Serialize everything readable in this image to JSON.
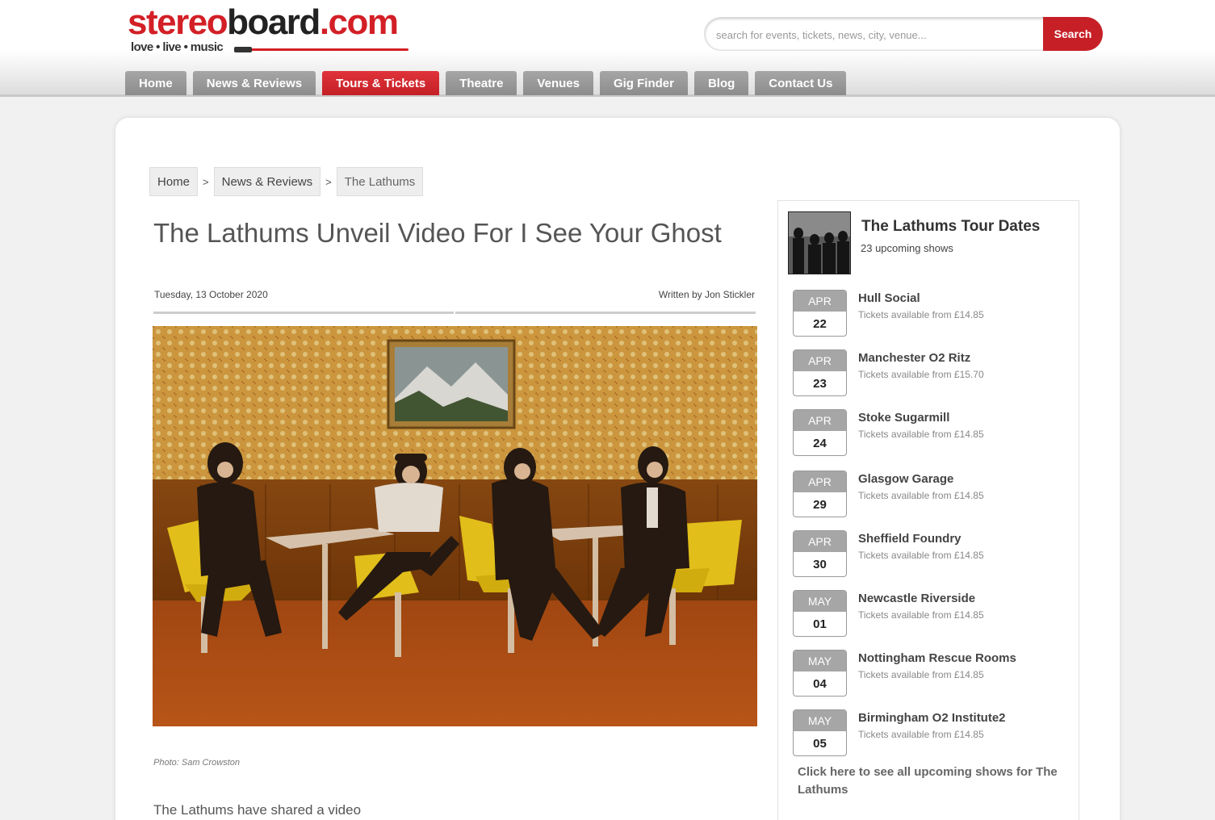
{
  "site": {
    "logo_text_red_1": "stereo",
    "logo_text_dark": "board",
    "logo_text_red_2": ".com",
    "tagline": "love • live • music",
    "search_placeholder": "search for events, tickets, news, city, venue...",
    "search_button": "Search"
  },
  "nav": [
    {
      "label": "Home"
    },
    {
      "label": "News & Reviews"
    },
    {
      "label": "Tours & Tickets",
      "active": true
    },
    {
      "label": "Theatre"
    },
    {
      "label": "Venues"
    },
    {
      "label": "Gig Finder"
    },
    {
      "label": "Blog"
    },
    {
      "label": "Contact Us"
    }
  ],
  "breadcrumb": {
    "home": "Home",
    "section": "News & Reviews",
    "current": "The Lathums",
    "separator": ">"
  },
  "article": {
    "title": "The Lathums Unveil Video For I See Your Ghost",
    "date": "Tuesday, 13 October 2020",
    "author": "Written by Jon Stickler",
    "photo_caption": "Photo: Sam Crowston",
    "body_start": "The Lathums have shared a video"
  },
  "tour": {
    "title": "The Lathums Tour Dates",
    "subtitle": "23 upcoming shows",
    "events": [
      {
        "month": "APR",
        "day": "22",
        "venue": "Hull Social",
        "price": "Tickets available from £14.85"
      },
      {
        "month": "APR",
        "day": "23",
        "venue": "Manchester O2 Ritz",
        "price": "Tickets available from £15.70"
      },
      {
        "month": "APR",
        "day": "24",
        "venue": "Stoke Sugarmill",
        "price": "Tickets available from £14.85"
      },
      {
        "month": "APR",
        "day": "29",
        "venue": "Glasgow Garage",
        "price": "Tickets available from £14.85"
      },
      {
        "month": "APR",
        "day": "30",
        "venue": "Sheffield Foundry",
        "price": "Tickets available from £14.85"
      },
      {
        "month": "MAY",
        "day": "01",
        "venue": "Newcastle Riverside",
        "price": "Tickets available from £14.85"
      },
      {
        "month": "MAY",
        "day": "04",
        "venue": "Nottingham Rescue Rooms",
        "price": "Tickets available from £14.85"
      },
      {
        "month": "MAY",
        "day": "05",
        "venue": "Birmingham O2 Institute2",
        "price": "Tickets available from £14.85"
      }
    ],
    "more_link": "Click here to see all upcoming shows for The Lathums"
  },
  "colors": {
    "brand_red": "#d31f26",
    "nav_grey": "#9a9a9a"
  }
}
